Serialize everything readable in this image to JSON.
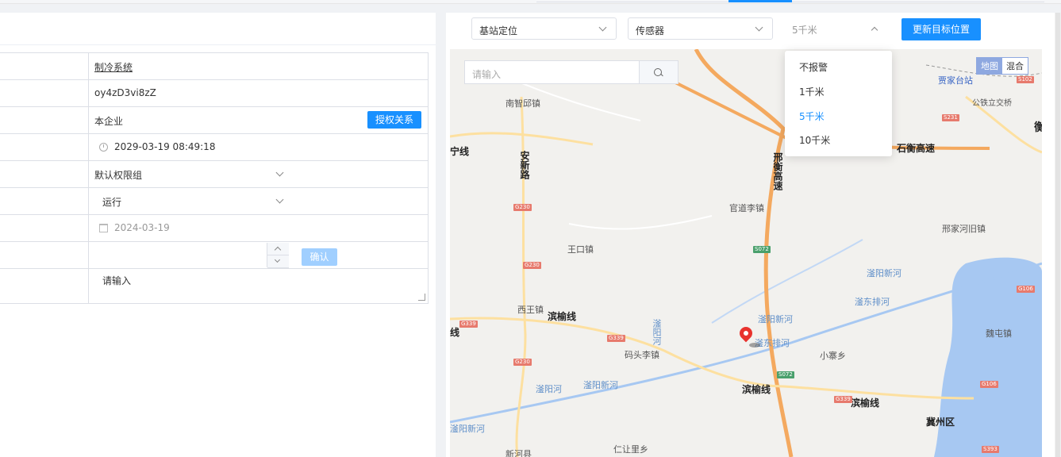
{
  "form": {
    "system_link": "制冷系统",
    "device_id": "oy4zD3vi8zZ",
    "enterprise": "本企业",
    "auth_button": "授权关系",
    "datetime": "2029-03-19 08:49:18",
    "permission_group": "默认权限组",
    "status": "运行",
    "date": "2024-03-19",
    "confirm_button": "确认",
    "remark_placeholder": "请输入"
  },
  "controls": {
    "locate_select": "基站定位",
    "sensor_select": "传感器",
    "range_select": "5千米",
    "update_button": "更新目标位置"
  },
  "range_options": [
    {
      "label": "不报警",
      "active": false
    },
    {
      "label": "1千米",
      "active": false
    },
    {
      "label": "5千米",
      "active": true
    },
    {
      "label": "10千米",
      "active": false
    }
  ],
  "map": {
    "search_placeholder": "请输入",
    "type_map": "地图",
    "type_hybrid": "混合",
    "labels": {
      "nanzhi": "南智邱镇",
      "anxin": "安新路",
      "xingheng": "邢衡高速",
      "guandao": "官道李镇",
      "wangkou": "王口镇",
      "xiwang": "西王镇",
      "binyu1": "滨榆线",
      "binyu2": "滨榆线",
      "binyu3": "滨榆线",
      "matou": "码头李镇",
      "fuyang1": "滏阳新河",
      "fuyang2": "滏阳新河",
      "fuyang3": "滏阳新河",
      "fuyang4": "滏阳新河",
      "fuyanghe": "滏阳河",
      "fuyanghe2": "滏阳河",
      "fudong1": "滏东排河",
      "fudong2": "滏东排河",
      "fuyanghe3": "滏阳河",
      "xiaozhai": "小寨乡",
      "jizhou": "冀州区",
      "xinhe": "新河县",
      "renrang": "仁让里乡",
      "shiheng": "石衡高速",
      "jiajia": "贾家台站",
      "gongtie": "公铁立交桥",
      "zoujia": "邢家河旧镇",
      "weitun": "魏屯镇",
      "heng": "衡",
      "ningxian": "宁线",
      "xian": "线"
    },
    "badges": {
      "g230a": "G230",
      "g230b": "G230",
      "g230c": "G230",
      "g339a": "G339",
      "g339b": "G339",
      "g339c": "G339",
      "s072a": "S072",
      "s072b": "S072",
      "s102": "S102",
      "s231": "S231",
      "g106a": "G106",
      "g106b": "G106",
      "s393": "S393"
    }
  },
  "colors": {
    "primary": "#1890ff",
    "disabled": "#a0cfff",
    "marker": "#e8322d"
  }
}
